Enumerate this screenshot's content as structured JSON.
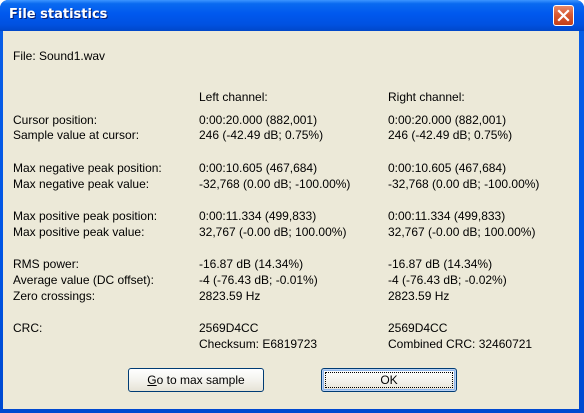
{
  "window": {
    "title": "File statistics"
  },
  "file_label": "File: Sound1.wav",
  "headers": {
    "left": "Left channel:",
    "right": "Right channel:"
  },
  "stats": {
    "cursor_position": {
      "label": "Cursor position:",
      "left": "0:00:20.000 (882,001)",
      "right": "0:00:20.000 (882,001)"
    },
    "sample_value": {
      "label": "Sample value at cursor:",
      "left": "246 (-42.49 dB; 0.75%)",
      "right": "246 (-42.49 dB; 0.75%)"
    },
    "max_neg_pos": {
      "label": "Max negative peak position:",
      "left": "0:00:10.605 (467,684)",
      "right": "0:00:10.605 (467,684)"
    },
    "max_neg_val": {
      "label": "Max negative peak value:",
      "left": "-32,768 (0.00 dB; -100.00%)",
      "right": "-32,768 (0.00 dB; -100.00%)"
    },
    "max_pos_pos": {
      "label": "Max positive peak position:",
      "left": "0:00:11.334 (499,833)",
      "right": "0:00:11.334 (499,833)"
    },
    "max_pos_val": {
      "label": "Max positive peak value:",
      "left": "32,767 (-0.00 dB; 100.00%)",
      "right": "32,767 (-0.00 dB; 100.00%)"
    },
    "rms_power": {
      "label": "RMS power:",
      "left": "-16.87 dB (14.34%)",
      "right": "-16.87 dB (14.34%)"
    },
    "dc_offset": {
      "label": "Average value (DC offset):",
      "left": "-4 (-76.43 dB; -0.01%)",
      "right": "-4 (-76.43 dB; -0.02%)"
    },
    "zero_crossings": {
      "label": "Zero crossings:",
      "left": "2823.59 Hz",
      "right": "2823.59 Hz"
    },
    "crc": {
      "label": "CRC:",
      "left": "2569D4CC",
      "right": "2569D4CC"
    },
    "checksum": {
      "left": "Checksum: E6819723",
      "right": "Combined CRC: 32460721"
    }
  },
  "buttons": {
    "goto_max_accel": "G",
    "goto_max_rest": "o to max sample",
    "ok": "OK"
  },
  "colors": {
    "titlebar": "#0058ee",
    "client": "#ece9d8",
    "close": "#d85a32"
  },
  "icons": {
    "close": "close-icon"
  }
}
